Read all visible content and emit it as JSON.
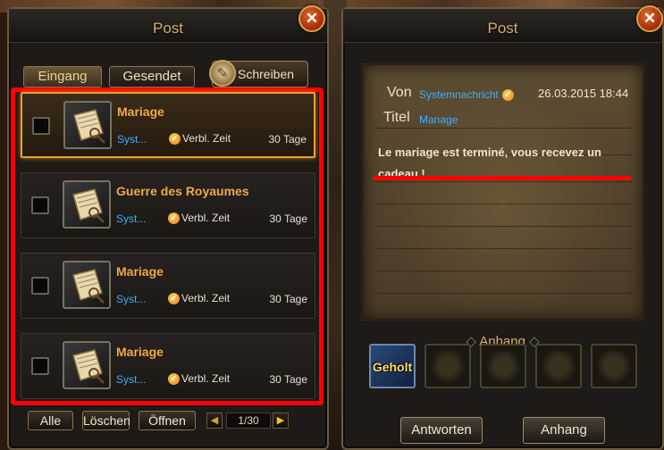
{
  "left_panel": {
    "title": "Post",
    "close_glyph": "✕",
    "tabs": [
      {
        "label": "Eingang",
        "active": true
      },
      {
        "label": "Gesendet",
        "active": false
      }
    ],
    "write_button": {
      "label": "Schreiben",
      "icon": "quill-scroll-icon"
    },
    "mails": [
      {
        "title": "Mariage",
        "sender": "Syst...",
        "time_label": "Verbl. Zeit",
        "days": "30 Tage",
        "selected": true
      },
      {
        "title": "Guerre des Royaumes",
        "sender": "Syst...",
        "time_label": "Verbl. Zeit",
        "days": "30 Tage",
        "selected": false
      },
      {
        "title": "Mariage",
        "sender": "Syst...",
        "time_label": "Verbl. Zeit",
        "days": "30 Tage",
        "selected": false
      },
      {
        "title": "Mariage",
        "sender": "Syst...",
        "time_label": "Verbl. Zeit",
        "days": "30 Tage",
        "selected": false
      }
    ],
    "footer": {
      "all_label": "Alle",
      "delete_label": "Löschen",
      "open_label": "Öffnen",
      "prev_glyph": "◀",
      "next_glyph": "▶",
      "page": "1/30"
    }
  },
  "right_panel": {
    "title": "Post",
    "close_glyph": "✕",
    "from_label": "Von",
    "from_value": "Systemnachricht",
    "date": "26.03.2015 18:44",
    "title_label": "Titel",
    "title_value": "Manage",
    "message": "Le mariage est terminé, vous recevez un cadeau !",
    "attachments_label": "Anhang",
    "attachment_collected_label": "Geholt",
    "reply_label": "Antworten",
    "attach_button_label": "Anhang"
  },
  "colors": {
    "accent_orange": "#f0a848",
    "sender_blue": "#3ab0ff",
    "highlight_red": "#ff0000",
    "gold": "#d8b068"
  }
}
